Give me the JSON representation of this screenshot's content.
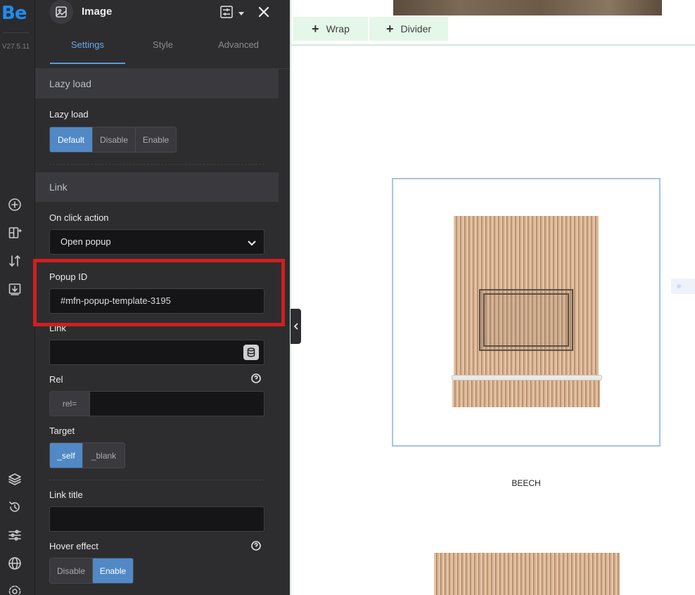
{
  "rail": {
    "logo": "Be",
    "version": "V27.5.11",
    "icons": [
      "add-circle-icon",
      "add-layout-icon",
      "sort-icon",
      "import-icon",
      "layers-icon",
      "history-icon",
      "sliders-icon",
      "globe-icon",
      "gear-icon"
    ]
  },
  "header": {
    "title": "Image",
    "icon": "image-icon"
  },
  "tabs": [
    "Settings",
    "Style",
    "Advanced"
  ],
  "lazy_section": {
    "title": "Lazy load",
    "field_label": "Lazy load",
    "options": [
      "Default",
      "Disable",
      "Enable"
    ],
    "selected": "Default"
  },
  "link_section": {
    "title": "Link",
    "on_click_label": "On click action",
    "on_click_value": "Open popup",
    "popup_id_label": "Popup ID",
    "popup_id_value": "#mfn-popup-template-3195",
    "link_label": "Link",
    "link_value": "",
    "rel_label": "Rel",
    "rel_prefix": "rel=",
    "rel_value": "",
    "target_label": "Target",
    "target_options": [
      "_self",
      "_blank"
    ],
    "target_selected": "_self",
    "link_title_label": "Link title",
    "link_title_value": "",
    "hover_label": "Hover effect",
    "hover_options": [
      "Disable",
      "Enable"
    ],
    "hover_selected": "Enable"
  },
  "canvas": {
    "add_wrap": "Wrap",
    "add_divider": "Divider",
    "caption": "BEECH"
  },
  "colors": {
    "accent": "#5089c6",
    "highlight": "#d11f1f",
    "panel_bg": "#2d2d30"
  }
}
